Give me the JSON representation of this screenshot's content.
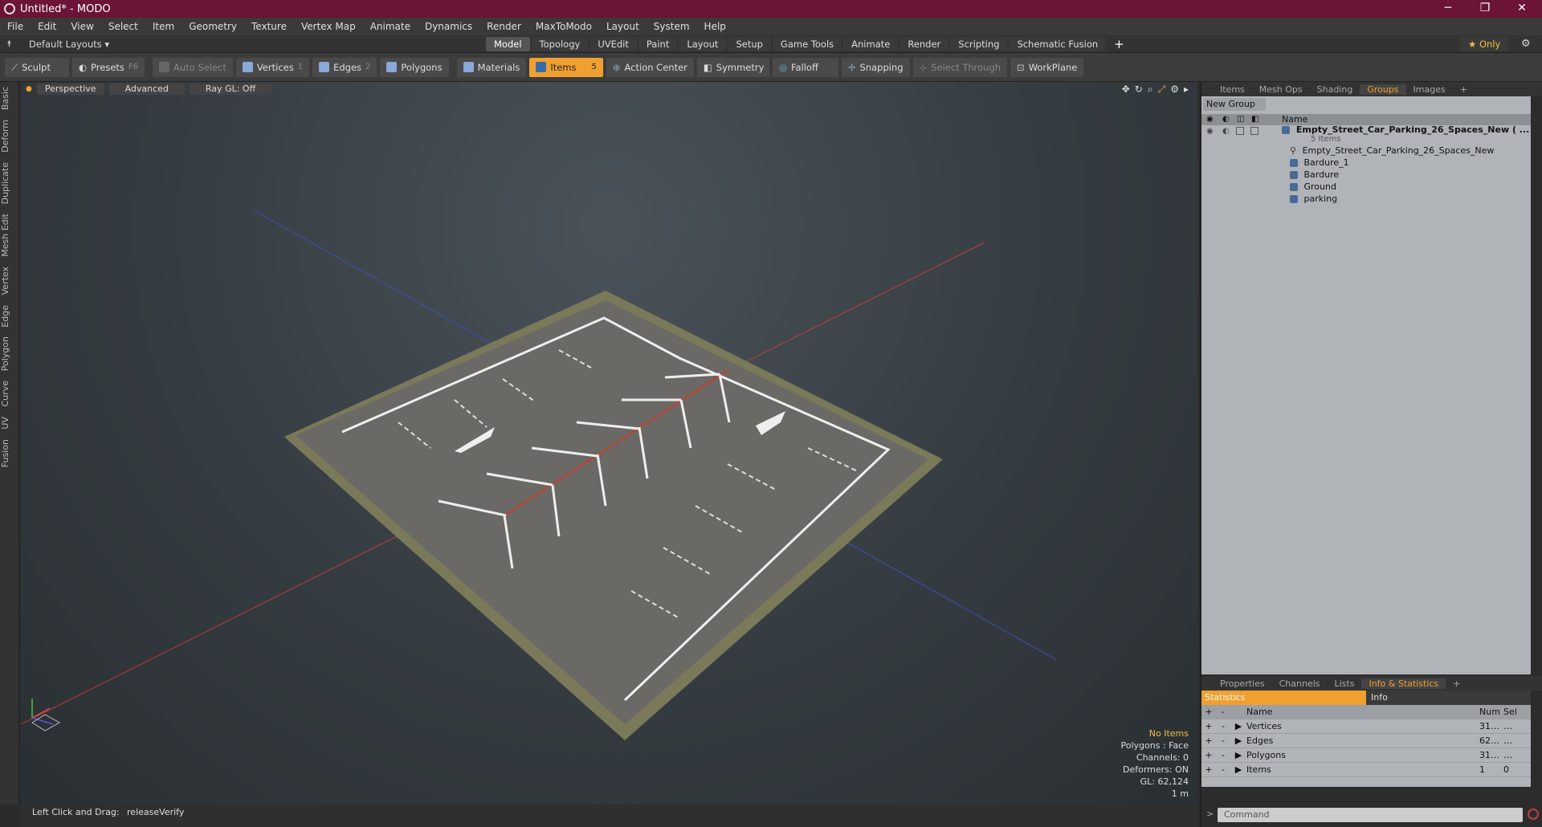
{
  "window": {
    "title": "Untitled* - MODO",
    "minimize": "─",
    "maximize": "❐",
    "close": "✕"
  },
  "menu": [
    "File",
    "Edit",
    "View",
    "Select",
    "Item",
    "Geometry",
    "Texture",
    "Vertex Map",
    "Animate",
    "Dynamics",
    "Render",
    "MaxToModo",
    "Layout",
    "System",
    "Help"
  ],
  "layoutbar": {
    "layouts_label": "Default Layouts ▾",
    "tabs": [
      "Model",
      "Topology",
      "UVEdit",
      "Paint",
      "Layout",
      "Setup",
      "Game Tools",
      "Animate",
      "Render",
      "Scripting",
      "Schematic Fusion"
    ],
    "active_tab": "Model",
    "add": "+",
    "only": "★  Only",
    "gear": "⚙"
  },
  "toolbar": {
    "sculpt": "Sculpt",
    "presets": "Presets",
    "presets_key": "F6",
    "auto_select": "Auto Select",
    "vertices": "Vertices",
    "vertices_count": "1",
    "edges": "Edges",
    "edges_count": "2",
    "polygons": "Polygons",
    "materials": "Materials",
    "items": "Items",
    "items_count": "5",
    "action_center": "Action Center",
    "symmetry": "Symmetry",
    "falloff": "Falloff",
    "snapping": "Snapping",
    "select_through": "Select Through",
    "workplane": "WorkPlane"
  },
  "left_tabs": [
    "Basic",
    "Deform",
    "Duplicate",
    "Mesh Edit",
    "Vertex",
    "Edge",
    "Polygon",
    "Curve",
    "UV",
    "Fusion"
  ],
  "viewport": {
    "view_mode": "Perspective",
    "shading": "Advanced",
    "raygl": "Ray GL: Off",
    "info": {
      "selection": "No Items",
      "polygons": "Polygons : Face",
      "channels": "Channels: 0",
      "deformers": "Deformers: ON",
      "gl": "GL: 62,124",
      "scale": "1 m"
    }
  },
  "status": {
    "label": "Left Click and Drag:",
    "value": "releaseVerify"
  },
  "right_top_tabs": [
    "Items",
    "Mesh Ops",
    "Shading",
    "Groups",
    "Images"
  ],
  "right_top_active": "Groups",
  "groups": {
    "new_group": "New Group",
    "name_header": "Name",
    "root": "Empty_Street_Car_Parking_26_Spaces_New ( ...",
    "root_count": "5 Items",
    "children": [
      "Empty_Street_Car_Parking_26_Spaces_New",
      "Bardure_1",
      "Bardure",
      "Ground",
      "parking"
    ]
  },
  "right_bottom_tabs": [
    "Properties",
    "Channels",
    "Lists",
    "Info & Statistics"
  ],
  "right_bottom_active": "Info & Statistics",
  "stats": {
    "tab_statistics": "Statistics",
    "tab_info": "Info",
    "headers": {
      "name": "Name",
      "num": "Num",
      "sel": "Sel"
    },
    "rows": [
      {
        "name": "Vertices",
        "num": "31…",
        "sel": "…"
      },
      {
        "name": "Edges",
        "num": "62…",
        "sel": "…"
      },
      {
        "name": "Polygons",
        "num": "31…",
        "sel": "…"
      },
      {
        "name": "Items",
        "num": "1",
        "sel": "0"
      }
    ]
  },
  "command": {
    "placeholder": "Command"
  }
}
